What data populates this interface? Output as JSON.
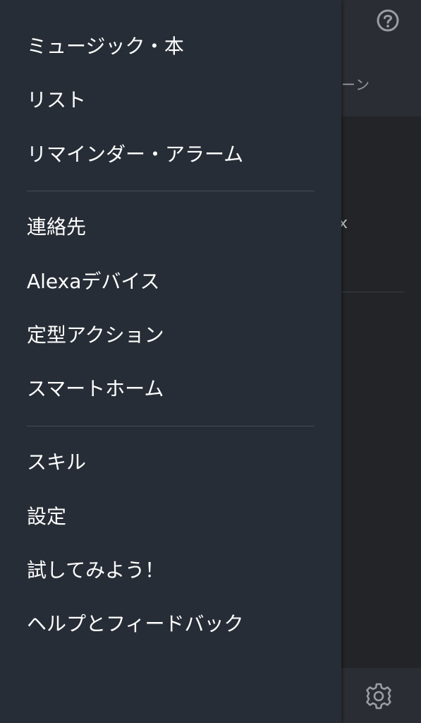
{
  "background": {
    "tab_fragment": "ーン",
    "close_fragment": "x",
    "icons": {
      "help": "help-circle-icon",
      "settings": "gear-icon"
    }
  },
  "drawer": {
    "groups": [
      [
        "ミュージック・本",
        "リスト",
        "リマインダー・アラーム"
      ],
      [
        "連絡先",
        "Alexaデバイス",
        "定型アクション",
        "スマートホーム"
      ],
      [
        "スキル",
        "設定",
        "試してみよう！",
        "ヘルプとフィードバック"
      ]
    ]
  },
  "colors": {
    "drawer_background": "#272d36",
    "menu_text": "#ffffff",
    "divider": "#454b55",
    "background_app": "#222428"
  }
}
